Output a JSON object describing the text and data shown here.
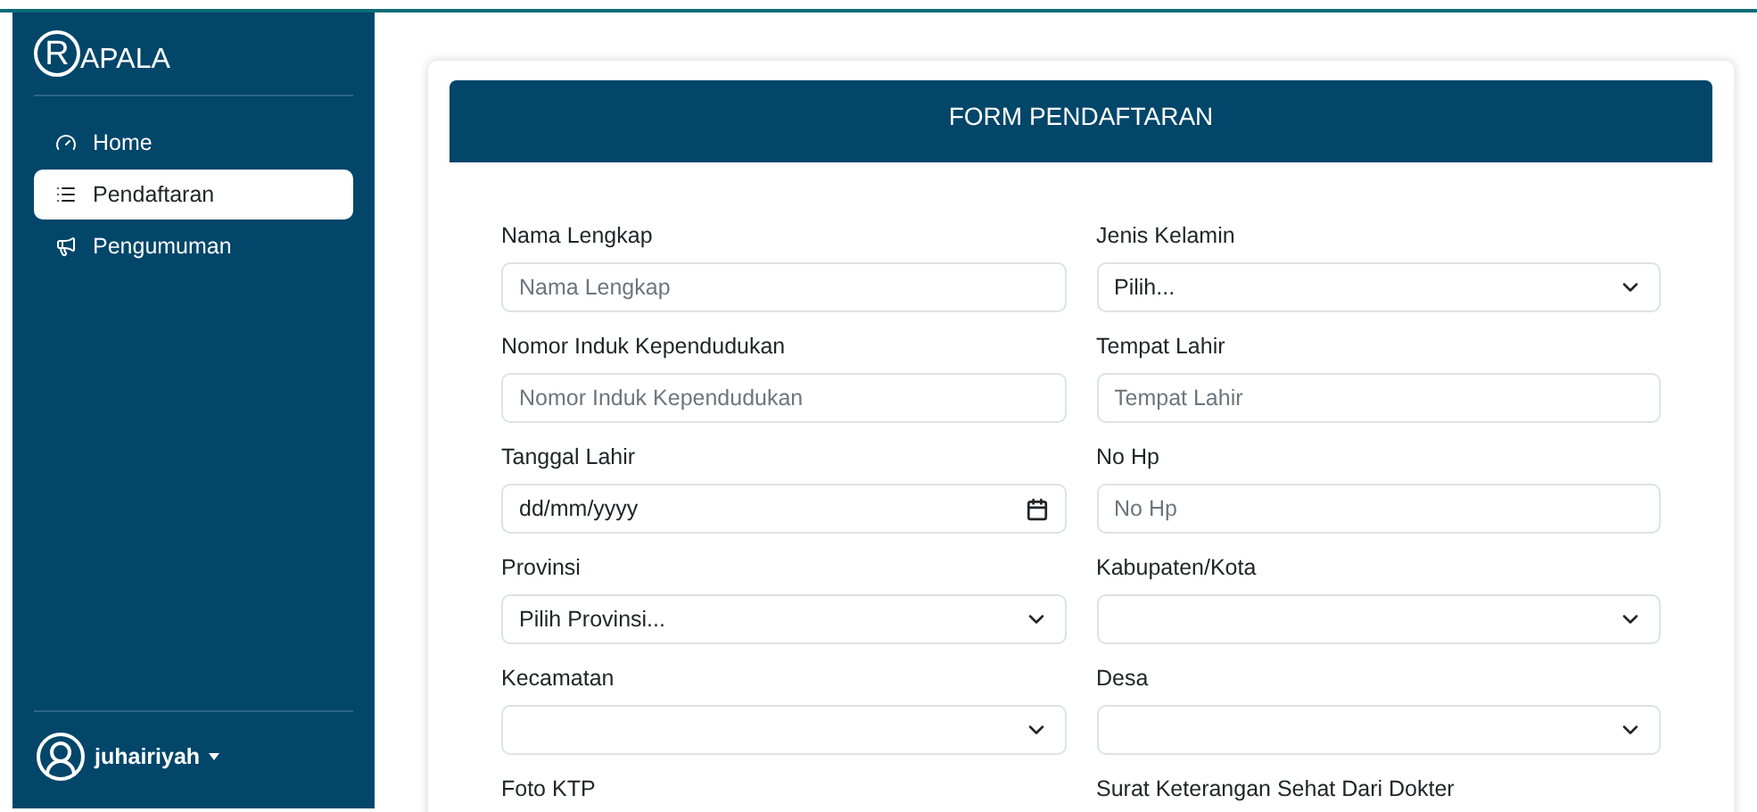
{
  "brand": {
    "mark": "R",
    "name": "APALA"
  },
  "menu": [
    {
      "label": "Home",
      "selected": false
    },
    {
      "label": "Pendaftaran",
      "selected": true
    },
    {
      "label": "Pengumuman",
      "selected": false
    }
  ],
  "user": {
    "name": "juhairiyah"
  },
  "form": {
    "title": "FORM PENDAFTARAN",
    "fields": [
      {
        "label": "Nama Lengkap",
        "kind": "text",
        "placeholder": "Nama Lengkap"
      },
      {
        "label": "Jenis Kelamin",
        "kind": "select",
        "value": "Pilih..."
      },
      {
        "label": "Nomor Induk Kependudukan",
        "kind": "text",
        "placeholder": "Nomor Induk Kependudukan"
      },
      {
        "label": "Tempat Lahir",
        "kind": "text",
        "placeholder": "Tempat Lahir"
      },
      {
        "label": "Tanggal Lahir",
        "kind": "date",
        "value": "dd/mm/yyyy"
      },
      {
        "label": "No Hp",
        "kind": "text",
        "placeholder": "No Hp"
      },
      {
        "label": "Provinsi",
        "kind": "select",
        "value": "Pilih Provinsi..."
      },
      {
        "label": "Kabupaten/Kota",
        "kind": "select"
      },
      {
        "label": "Kecamatan",
        "kind": "select"
      },
      {
        "label": "Desa",
        "kind": "select"
      },
      {
        "label": "Foto KTP",
        "kind": "label"
      },
      {
        "label": "Surat Keterangan Sehat Dari Dokter",
        "kind": "label"
      }
    ]
  }
}
